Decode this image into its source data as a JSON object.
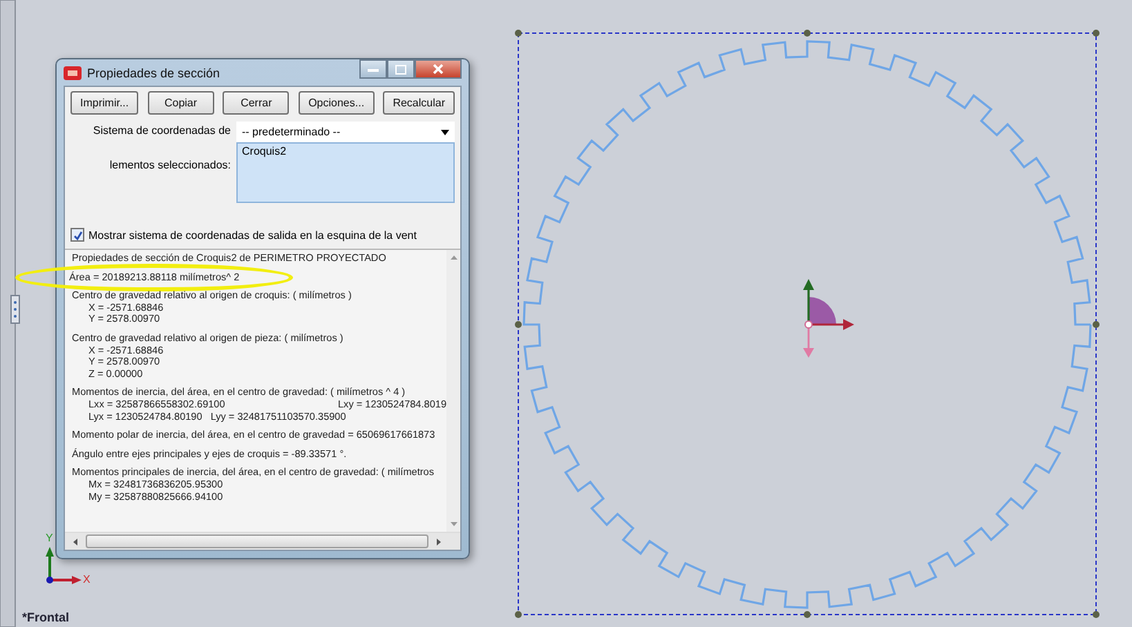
{
  "view_label": "*Frontal",
  "axis_labels": [
    "Y",
    "X"
  ],
  "dialog": {
    "title": "Propiedades de sección",
    "buttons": [
      "Imprimir...",
      "Copiar",
      "Cerrar",
      "Opciones...",
      "Recalcular"
    ],
    "coord_label": "Sistema de coordenadas de",
    "coord_value": "-- predeterminado --",
    "selection_label": "lementos seleccionados:",
    "selection_items": [
      "Croquis2"
    ],
    "show_coords": {
      "label": "Mostrar sistema de coordenadas de salida en la esquina de la vent",
      "checked": true
    },
    "results": [
      {
        "heading": "Propiedades de sección de Croquis2 de PERIMETRO PROYECTADO",
        "highlighted": false
      },
      {
        "heading": "Área = 20189213.88118 milímetros^ 2",
        "highlighted": true
      },
      {
        "heading": "Centro de gravedad relativo al origen de croquis: ( milímetros )",
        "highlighted": false,
        "rows": [
          [
            "X = -2571.68846"
          ],
          [
            "Y = 2578.00970"
          ]
        ]
      },
      {
        "heading": "Centro de gravedad relativo al origen de pieza: ( milímetros )",
        "highlighted": false,
        "rows": [
          [
            "X = -2571.68846"
          ],
          [
            "Y = 2578.00970"
          ],
          [
            "Z = 0.00000"
          ]
        ]
      },
      {
        "heading": "Momentos de inercia, del área, en el centro de gravedad: ( milímetros ^ 4 )",
        "highlighted": false,
        "rows": [
          [
            "Lxx = 32587866558302.69100",
            "Lxy = 1230524784.8019"
          ],
          [
            "Lyx = 1230524784.80190",
            "Lyy = 32481751103570.35900"
          ]
        ]
      },
      {
        "heading": "Momento polar de inercia, del área, en el centro de gravedad = 65069617661873",
        "highlighted": false
      },
      {
        "heading": "Ángulo entre ejes principales y ejes de croquis = -89.33571 °.",
        "highlighted": false
      },
      {
        "heading": "Momentos principales de inercia, del área, en el centro de gravedad: ( milímetros",
        "highlighted": false,
        "rows": [
          [
            "Mx = 32481736836205.95300"
          ],
          [
            "My = 32587880825666.94100"
          ]
        ]
      }
    ]
  }
}
